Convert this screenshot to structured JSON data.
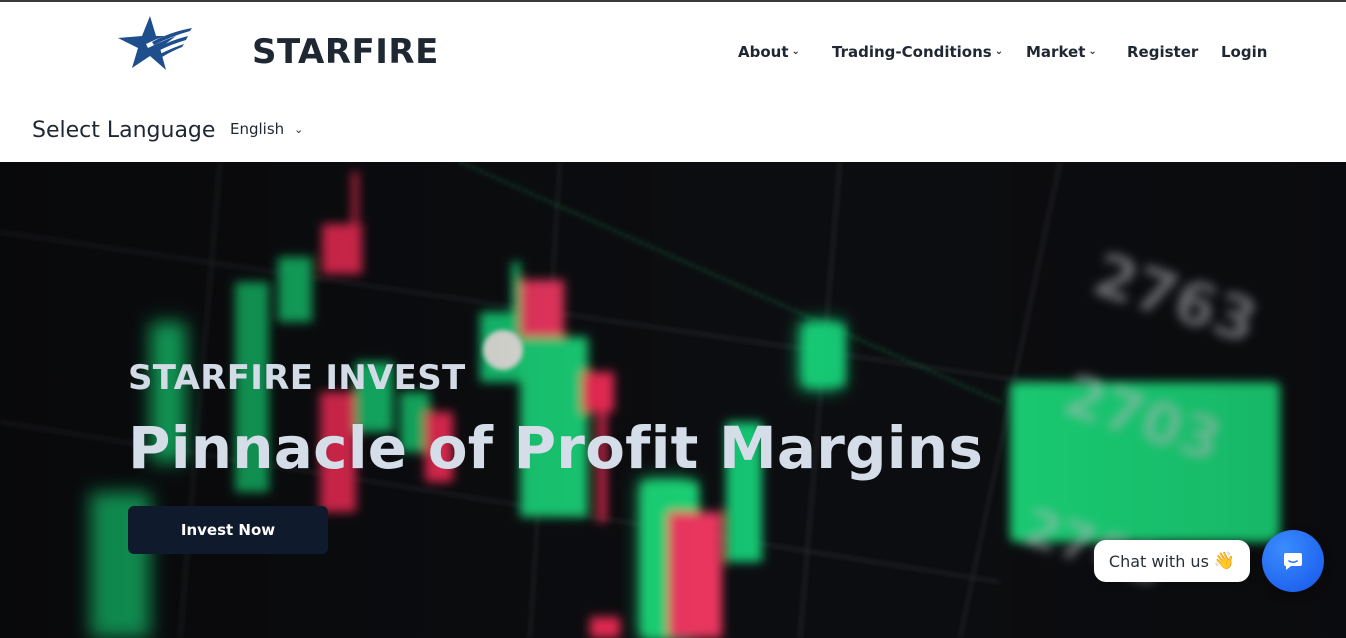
{
  "header": {
    "brand": "STARFIRE",
    "logo_icon": "star-logo-icon",
    "nav": {
      "about": "About",
      "trading": "Trading-Conditions",
      "market": "Market",
      "register": "Register",
      "login": "Login"
    }
  },
  "language": {
    "label": "Select Language",
    "selected": "English"
  },
  "hero": {
    "kicker": "STARFIRE INVEST",
    "title": "Pinnacle of Profit Margins",
    "cta": "Invest Now"
  },
  "chat": {
    "bubble": "Chat with us",
    "wave": "👋",
    "icon": "chat-icon"
  },
  "colors": {
    "brand_navy": "#1f4e8c",
    "button_dark": "#0f1a2c",
    "chat_blue": "#1f6fff",
    "candle_green": "#19d37a",
    "candle_red": "#ff2d5c"
  }
}
